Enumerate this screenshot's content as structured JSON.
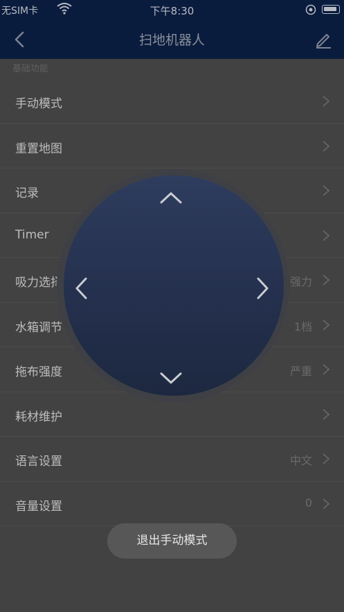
{
  "status_bar": {
    "carrier": "无SIM卡",
    "time": "下午8:30"
  },
  "nav": {
    "title": "扫地机器人"
  },
  "section_header": "基础功能",
  "rows": [
    {
      "label": "手动模式",
      "value": ""
    },
    {
      "label": "重置地图",
      "value": ""
    },
    {
      "label": "记录",
      "value": ""
    },
    {
      "label": "Timer",
      "value": ""
    },
    {
      "label": "吸力选择",
      "value": "强力"
    },
    {
      "label": "水箱调节",
      "value": "1档"
    },
    {
      "label": "拖布强度",
      "value": "严重"
    },
    {
      "label": "耗材维护",
      "value": ""
    },
    {
      "label": "语言设置",
      "value": "中文"
    },
    {
      "label": "音量设置",
      "value": "0"
    }
  ],
  "exit_button": "退出手动模式",
  "icons": {
    "back": "chevron-left-icon",
    "edit": "pencil-icon",
    "row_chevron": "chevron-right-icon",
    "joystick": [
      "arrow-up-icon",
      "arrow-down-icon",
      "arrow-left-icon",
      "arrow-right-icon"
    ]
  },
  "colors": {
    "nav_background": "#0a1c3e",
    "overlay": "#424242",
    "joystick": "#24304d"
  }
}
